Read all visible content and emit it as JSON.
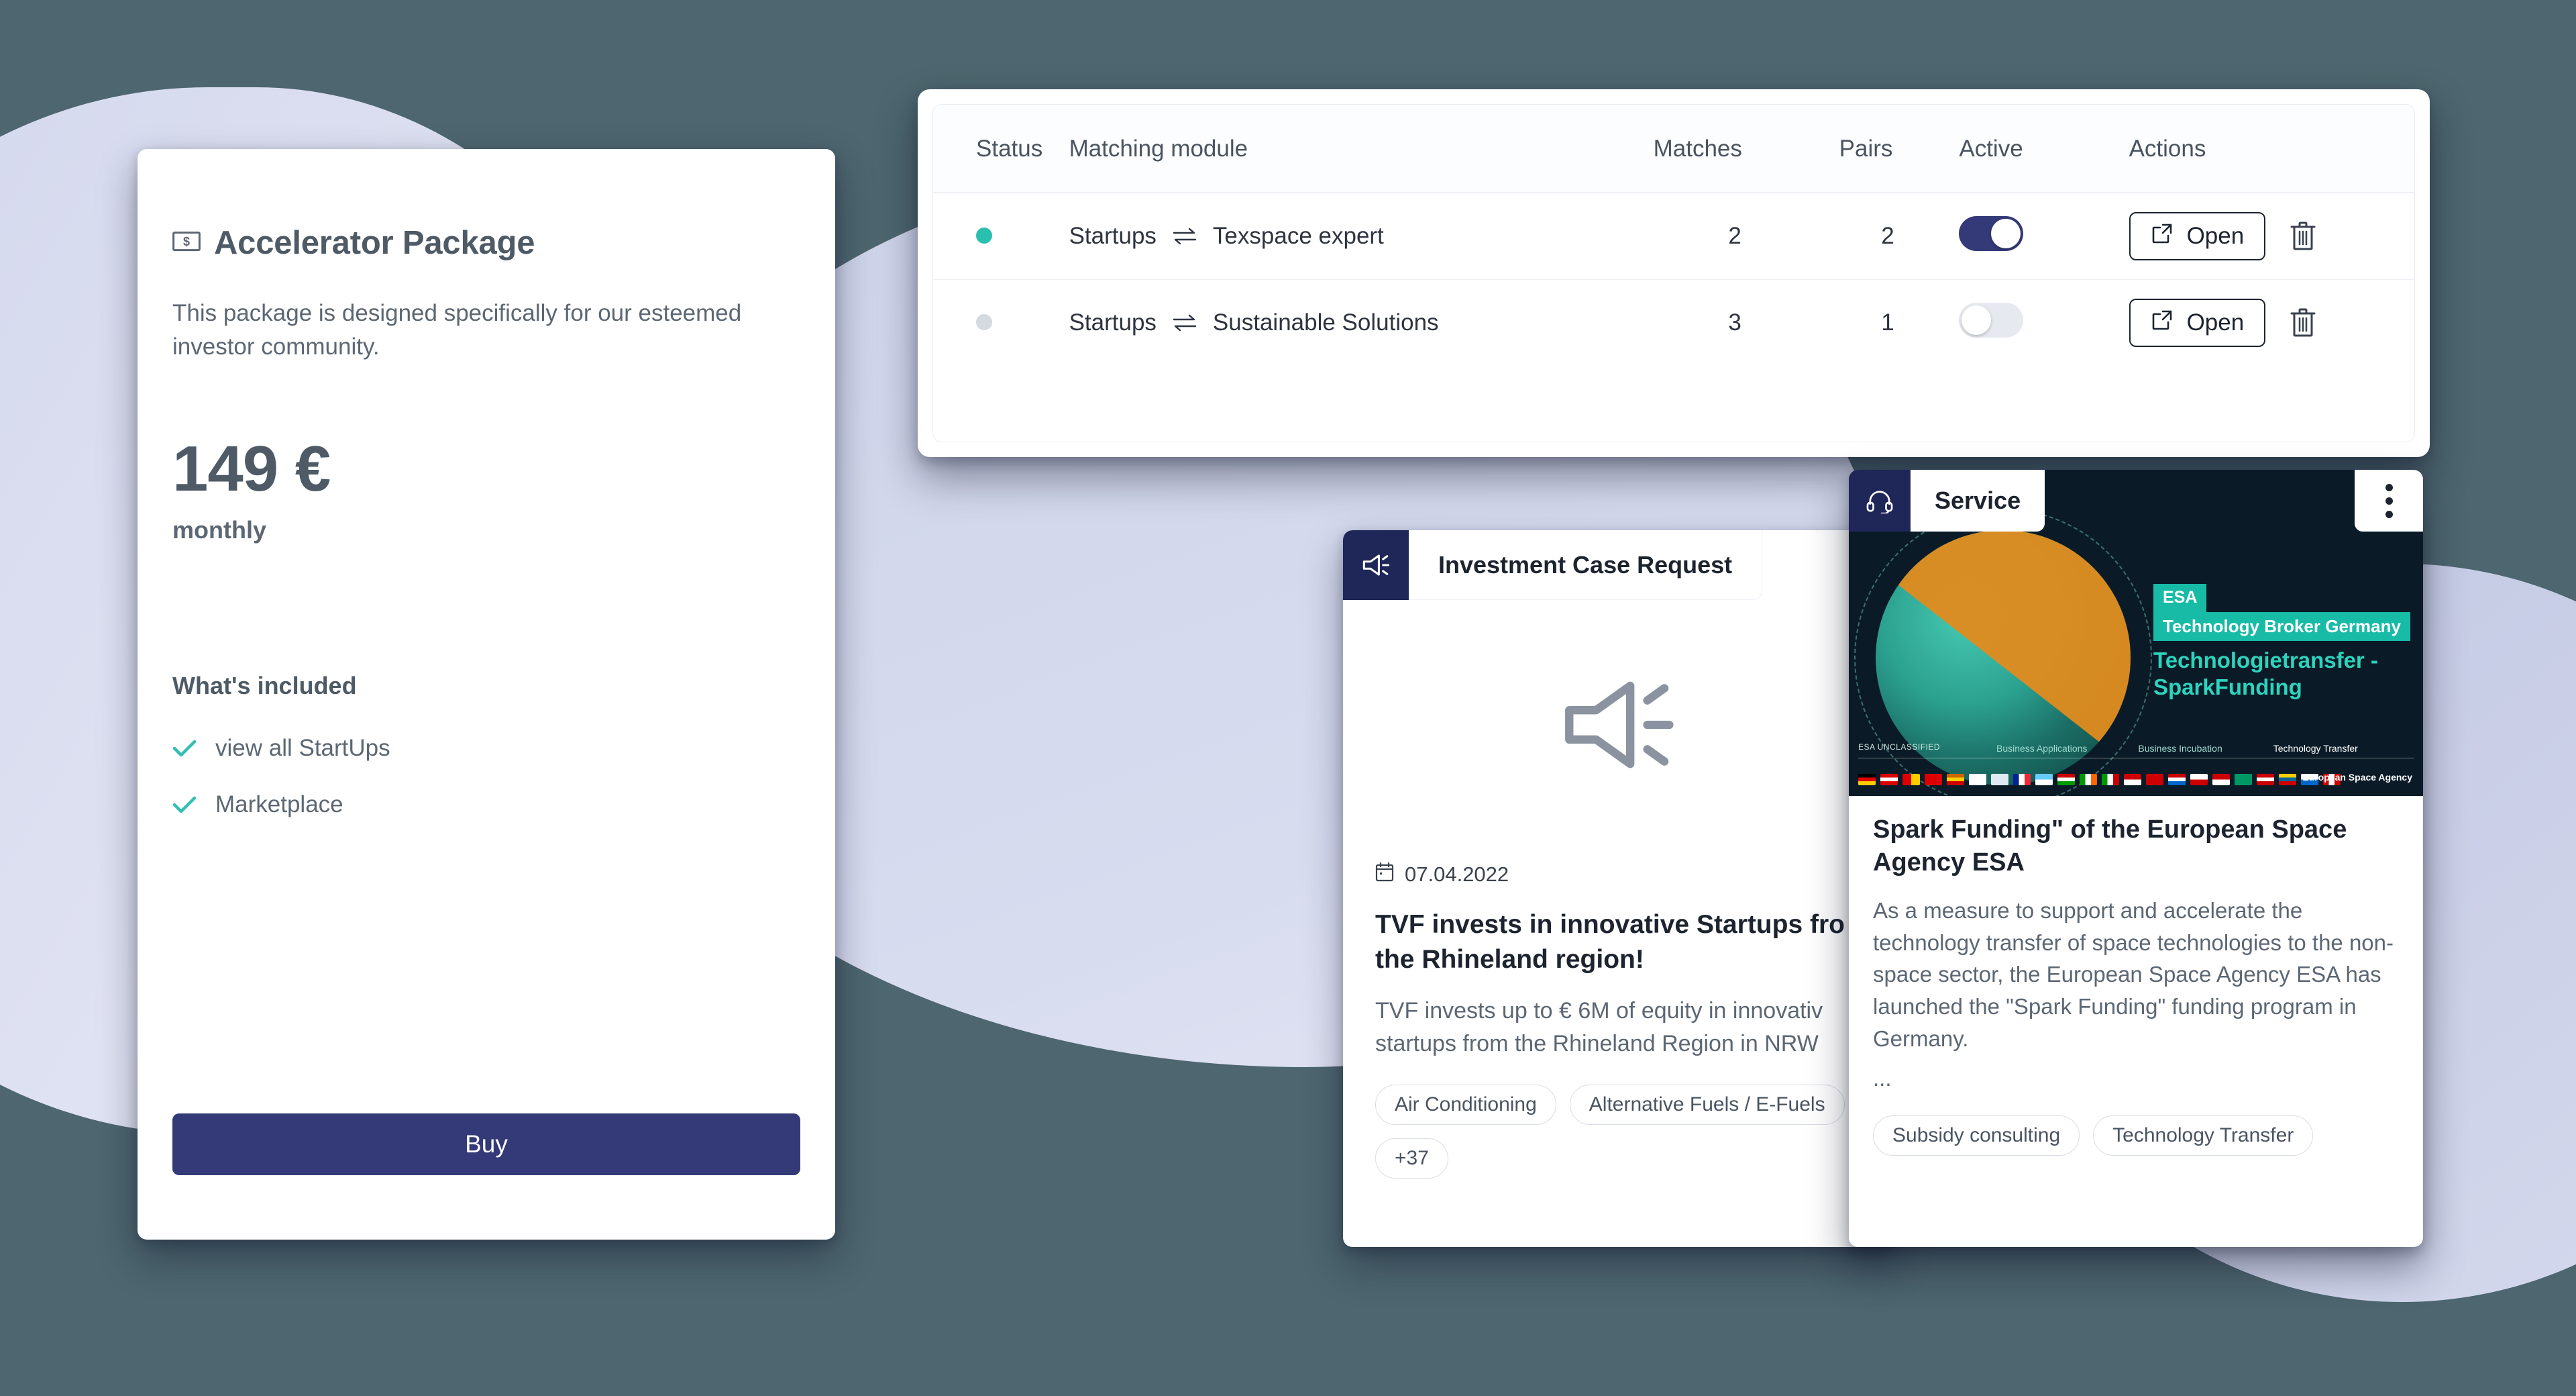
{
  "theme": {
    "background": "#4d666f",
    "blob": "#cdd2ea",
    "primary": "#343a77",
    "accent_teal": "#2bbfb2",
    "dark_navy": "#1e2757",
    "esa_teal": "#17bba6"
  },
  "package_card": {
    "icon": "money-note-icon",
    "title": "Accelerator Package",
    "description": "This package is designed specifically for our esteemed investor community.",
    "price": "149 €",
    "period": "monthly",
    "included_heading": "What's included",
    "features": [
      {
        "icon": "check-icon",
        "label": "view all StartUps"
      },
      {
        "icon": "check-icon",
        "label": "Marketplace"
      }
    ],
    "buy_label": "Buy"
  },
  "matching_table": {
    "columns": [
      "Status",
      "Matching module",
      "Matches",
      "Pairs",
      "Active",
      "Actions"
    ],
    "rows": [
      {
        "status": "active",
        "source": "Startups",
        "relation_icon": "swap-arrows-icon",
        "target": "Texspace expert",
        "matches": "2",
        "pairs": "2",
        "active": true,
        "open_label": "Open",
        "open_icon": "external-link-icon",
        "delete_icon": "trash-icon"
      },
      {
        "status": "inactive",
        "source": "Startups",
        "relation_icon": "swap-arrows-icon",
        "target": "Sustainable Solutions",
        "matches": "3",
        "pairs": "1",
        "active": false,
        "open_label": "Open",
        "open_icon": "external-link-icon",
        "delete_icon": "trash-icon"
      }
    ]
  },
  "news_card": {
    "badge_icon": "megaphone-icon",
    "badge_label": "Investment Case Request",
    "hero_icon": "megaphone-icon",
    "date_icon": "calendar-icon",
    "date": "07.04.2022",
    "title_line1": "TVF invests in innovative Startups fro",
    "title_line2": "the Rhineland region!",
    "text_line1": "TVF invests up to € 6M of equity in innovativ",
    "text_line2": "startups from the Rhineland Region in NRW",
    "chips": [
      "Air Conditioning",
      "Alternative Fuels / E-Fuels",
      "+37"
    ]
  },
  "service_card": {
    "badge_icon": "headset-icon",
    "badge_label": "Service",
    "menu_icon": "more-vertical-icon",
    "hero": {
      "tag_esa": "ESA",
      "tag_broker": "Technology Broker Germany",
      "headline_line1": "Technologietransfer -",
      "headline_line2": "SparkFunding",
      "classification": "ESA UNCLASSIFIED",
      "footer_labels": [
        "Business Applications",
        "Business Incubation",
        "Technology Transfer"
      ],
      "credit": "European Space Agency"
    },
    "title": "Spark Funding\" of the European Space Agency ESA",
    "text": "As a measure to support and accelerate the technology transfer of space technologies to the non-space sector, the European Space Agency ESA has launched the \"Spark Funding\" funding program in Germany.",
    "ellipsis": "...",
    "chips": [
      "Subsidy consulting",
      "Technology Transfer"
    ]
  }
}
